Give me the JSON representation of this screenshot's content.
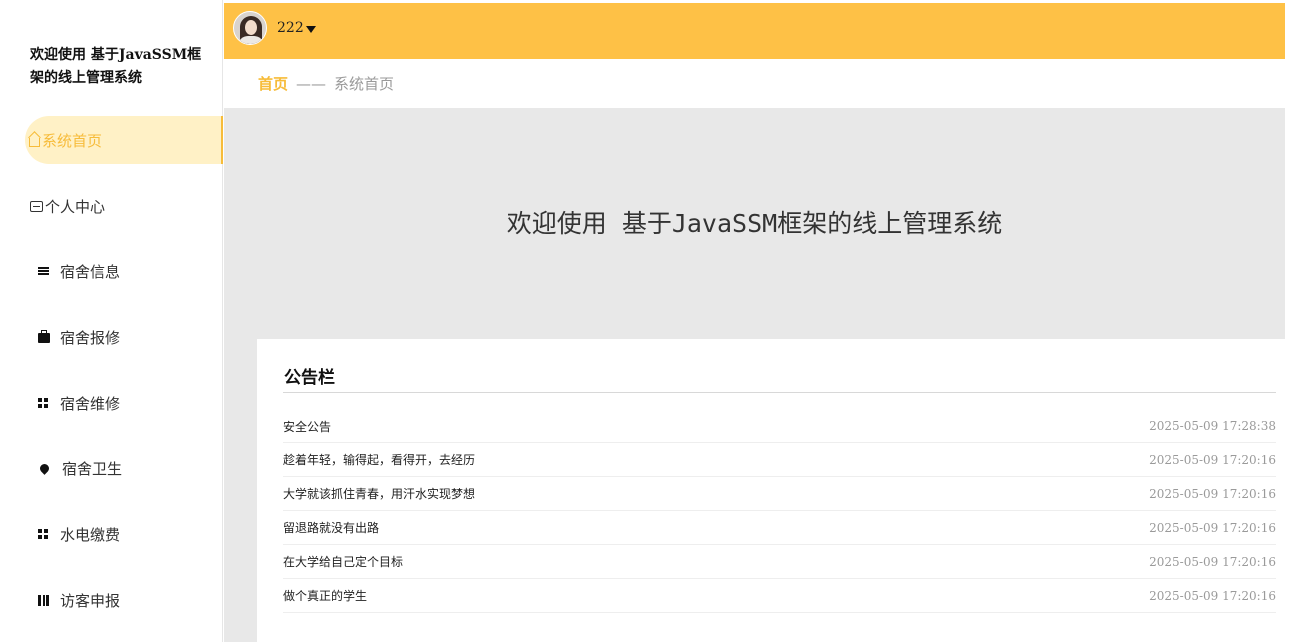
{
  "sidebar": {
    "title": "欢迎使用 基于JavaSSM框架的线上管理系统",
    "items": [
      {
        "label": "系统首页",
        "icon": "home-icon",
        "active": true
      },
      {
        "label": "个人中心",
        "icon": "card-icon",
        "active": false
      },
      {
        "label": "宿舍信息",
        "icon": "list-icon",
        "active": false
      },
      {
        "label": "宿舍报修",
        "icon": "briefcase-icon",
        "active": false
      },
      {
        "label": "宿舍维修",
        "icon": "grid-icon",
        "active": false
      },
      {
        "label": "宿舍卫生",
        "icon": "drop-icon",
        "active": false
      },
      {
        "label": "水电缴费",
        "icon": "grid-icon",
        "active": false
      },
      {
        "label": "访客申报",
        "icon": "book-icon",
        "active": false
      }
    ]
  },
  "header": {
    "username": "222",
    "avatar_icon": "user-avatar"
  },
  "breadcrumb": {
    "home": "首页",
    "separator": "——",
    "current": "系统首页"
  },
  "main": {
    "welcome": "欢迎使用 基于JavaSSM框架的线上管理系统"
  },
  "notice": {
    "title": "公告栏",
    "items": [
      {
        "text": "安全公告",
        "time": "2025-05-09 17:28:38"
      },
      {
        "text": "趁着年轻，输得起，看得开，去经历",
        "time": "2025-05-09 17:20:16"
      },
      {
        "text": "大学就该抓住青春，用汗水实现梦想",
        "time": "2025-05-09 17:20:16"
      },
      {
        "text": "留退路就没有出路",
        "time": "2025-05-09 17:20:16"
      },
      {
        "text": "在大学给自己定个目标",
        "time": "2025-05-09 17:20:16"
      },
      {
        "text": "做个真正的学生",
        "time": "2025-05-09 17:20:16"
      }
    ]
  },
  "colors": {
    "accent": "#fec146",
    "active_text": "#f7bc3a",
    "active_bg": "#fff1c6",
    "main_bg": "#e8e8e8"
  }
}
